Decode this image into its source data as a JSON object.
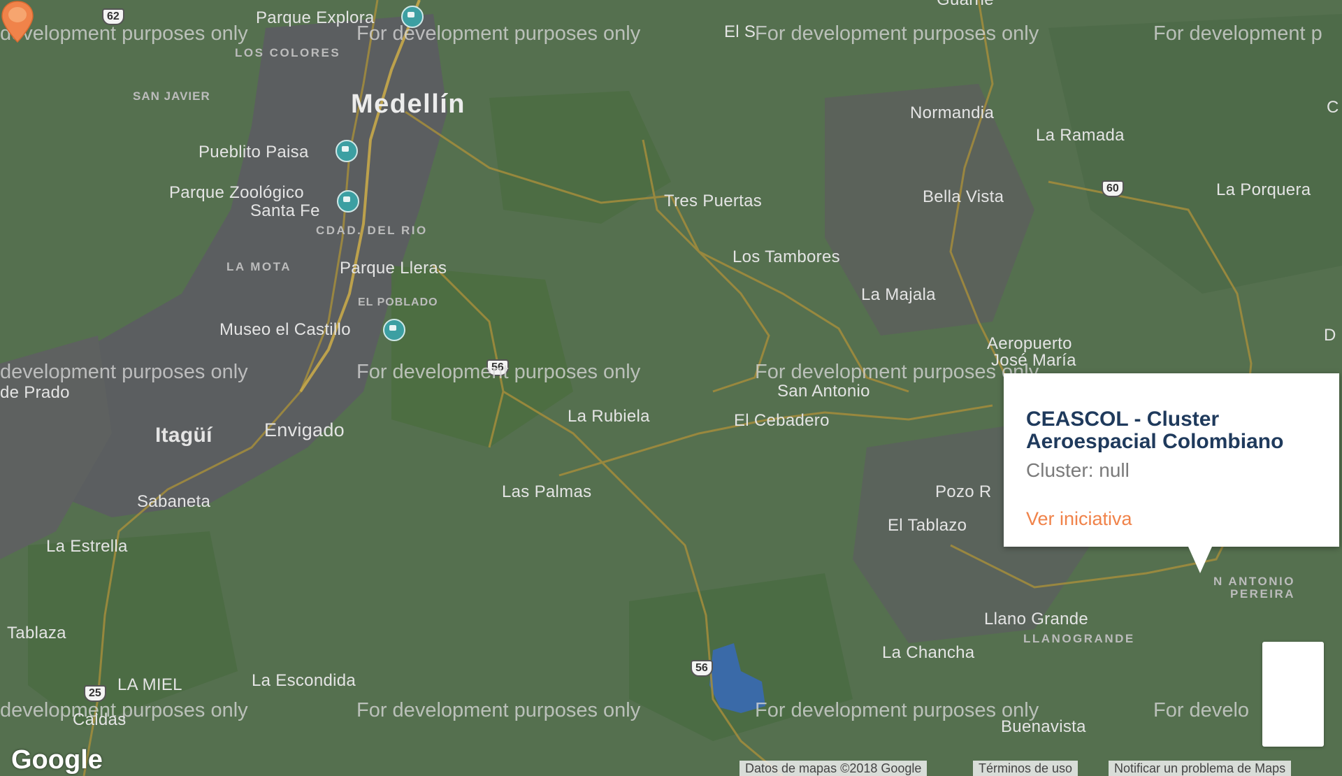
{
  "map": {
    "places": {
      "medellin": "Medellín",
      "itagui": "Itagüí",
      "envigado": "Envigado",
      "parque_explora": "Parque Explora",
      "pueblito_paisa": "Pueblito Paisa",
      "parque_zoologico_1": "Parque Zoológico",
      "parque_zoologico_2": "Santa Fe",
      "parque_lleras": "Parque Lleras",
      "museo_castillo": "Museo el Castillo",
      "de_prado": "de Prado",
      "sabaneta": "Sabaneta",
      "la_estrella": "La Estrella",
      "tablaza": "Tablaza",
      "la_miel": "LA MIEL",
      "caldas": "Caldas",
      "la_escondida": "La Escondida",
      "tres_puertas": "Tres Puertas",
      "los_tambores": "Los Tambores",
      "la_majala": "La Majala",
      "la_rubiela": "La Rubiela",
      "el_cebadero": "El Cebadero",
      "san_antonio": "San Antonio",
      "las_palmas": "Las Palmas",
      "normandia": "Normandia",
      "la_ramada": "La Ramada",
      "bella_vista": "Bella Vista",
      "la_porquera": "La Porquera",
      "aeropuerto_1": "Aeropuerto",
      "aeropuerto_2": "José María",
      "pozo_r": "Pozo R",
      "el_tablazo": "El Tablazo",
      "llano_grande": "Llano Grande",
      "la_chancha": "La Chancha",
      "buenavista": "Buenavista",
      "el_s": "El S",
      "edge_c": "C",
      "edge_d": "D",
      "top_cut": "Guarne"
    },
    "neighborhoods": {
      "los_colores": "LOS COLORES",
      "san_javier": "SAN JAVIER",
      "cdad_del_rio": "CDAD. DEL RIO",
      "la_mota": "LA MOTA",
      "el_poblado": "EL POBLADO",
      "llanogrande": "LLANOGRANDE",
      "san_antonio_pereira_1": "N ANTONIO",
      "san_antonio_pereira_2": "PEREIRA"
    },
    "route_shields": {
      "r62": "62",
      "r60": "60",
      "r56a": "56",
      "r56b": "56",
      "r25": "25"
    },
    "watermark": "For development purposes only",
    "watermark_cut_left": "development purposes only",
    "watermark_cut_right_1": "For development p",
    "watermark_cut_right_2": "For develo"
  },
  "popup": {
    "title": "CEASCOL - Cluster Aeroespacial Colombiano",
    "subtitle": "Cluster: null",
    "link": "Ver iniciativa"
  },
  "footer": {
    "logo": "Google",
    "map_data": "Datos de mapas ©2018 Google",
    "terms": "Términos de uso",
    "report": "Notificar un problema de Maps"
  },
  "colors": {
    "popup_title": "#1f3a5c",
    "popup_link": "#f0834a",
    "marker": "#f0834a",
    "water": "#3a6aa8"
  }
}
